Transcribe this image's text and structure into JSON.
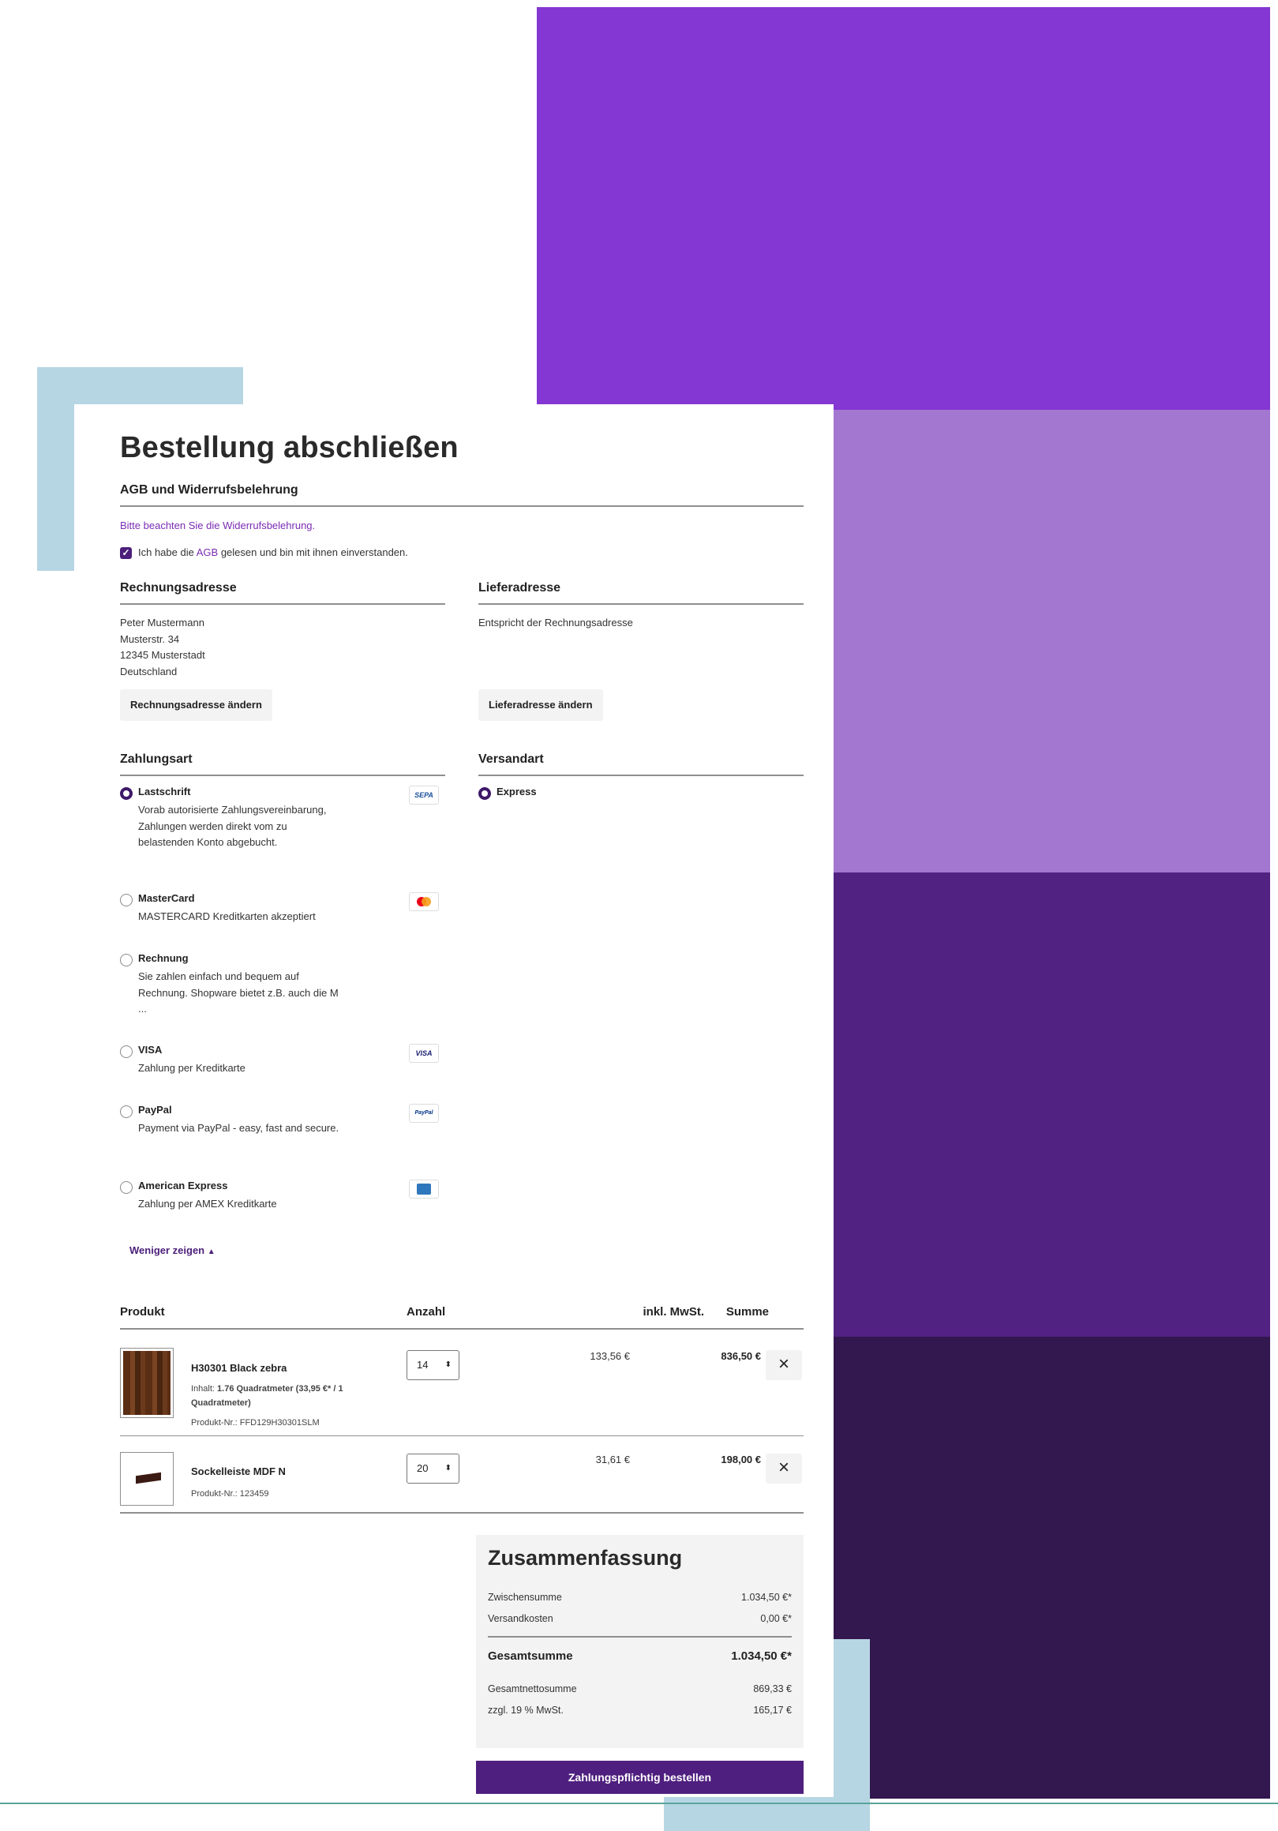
{
  "colors": {
    "purple1": "#8437d3",
    "purple2": "#a377cf",
    "purple3": "#522282",
    "purple4": "#33174f",
    "lightblue": "#b6d6e3",
    "brand": "#4b1f7a",
    "link": "#7a2bb3"
  },
  "page_title": "Bestellung abschließen",
  "agb": {
    "heading": "AGB und Widerrufsbelehrung",
    "notice": "Bitte beachten Sie die Widerrufsbelehrung.",
    "check_before": "Ich habe die ",
    "check_link": "AGB",
    "check_after": " gelesen und bin mit ihnen einverstanden.",
    "checked": true
  },
  "billing": {
    "heading": "Rechnungsadresse",
    "lines": [
      "Peter Mustermann",
      "Musterstr. 34",
      "12345 Musterstadt",
      "Deutschland"
    ],
    "button": "Rechnungsadresse ändern"
  },
  "shipping": {
    "heading": "Lieferadresse",
    "text": "Entspricht der Rechnungsadresse",
    "button": "Lieferadresse ändern"
  },
  "payment": {
    "heading": "Zahlungsart",
    "methods": [
      {
        "name": "Lastschrift",
        "desc": "Vorab autorisierte Zahlungsvereinbarung, Zahlungen werden direkt vom zu belastenden Konto abgebucht.",
        "selected": true,
        "logo": "SEPA"
      },
      {
        "name": "MasterCard",
        "desc": "MASTERCARD Kreditkarten akzeptiert",
        "selected": false,
        "logo": "mastercard"
      },
      {
        "name": "Rechnung",
        "desc": "Sie zahlen einfach und bequem auf Rechnung. Shopware bietet z.B. auch die M ...",
        "selected": false,
        "logo": ""
      },
      {
        "name": "VISA",
        "desc": "Zahlung per Kreditkarte",
        "selected": false,
        "logo": "VISA"
      },
      {
        "name": "PayPal",
        "desc": "Payment via PayPal - easy, fast and secure.",
        "selected": false,
        "logo": "PayPal"
      },
      {
        "name": "American Express",
        "desc": "Zahlung per AMEX Kreditkarte",
        "selected": false,
        "logo": "amex"
      }
    ],
    "less": "Weniger zeigen"
  },
  "shipping_method": {
    "heading": "Versandart",
    "options": [
      {
        "name": "Express",
        "selected": true
      }
    ]
  },
  "cart": {
    "headers": {
      "product": "Produkt",
      "qty": "Anzahl",
      "tax": "inkl. MwSt.",
      "total": "Summe"
    },
    "items": [
      {
        "name": "H30301 Black zebra",
        "content_label": "Inhalt: ",
        "content": "1.76 Quadratmeter (33,95 €* / 1 Quadratmeter)",
        "number": "Produkt-Nr.: FFD129H30301SLM",
        "qty": "14",
        "tax": "133,56 €",
        "total": "836,50 €"
      },
      {
        "name": "Sockelleiste MDF N",
        "number": "Produkt-Nr.: 123459",
        "qty": "20",
        "tax": "31,61 €",
        "total": "198,00 €"
      }
    ]
  },
  "summary": {
    "heading": "Zusammenfassung",
    "subtotal_label": "Zwischensumme",
    "subtotal": "1.034,50 €*",
    "shipping_label": "Versandkosten",
    "shipping": "0,00 €*",
    "grand_label": "Gesamtsumme",
    "grand": "1.034,50 €*",
    "net_label": "Gesamtnettosumme",
    "net": "869,33 €",
    "vat_label": "zzgl. 19 % MwSt.",
    "vat": "165,17 €"
  },
  "order_button": "Zahlungspflichtig bestellen"
}
